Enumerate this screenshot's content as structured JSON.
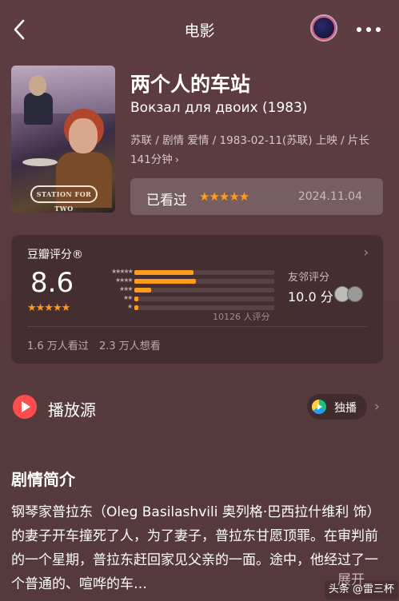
{
  "header": {
    "title": "电影",
    "back_icon": "chevron-left-icon",
    "more_icon": "more-dots-icon"
  },
  "movie": {
    "title_cn": "两个人的车站",
    "title_original": "Вокзал для двоих (1983)",
    "meta_line1": "苏联 / 剧情 爱情 / 1983-02-11(苏联) 上映 / 片长",
    "meta_line2": "141分钟",
    "poster_logo_text": "STATION FOR TWO"
  },
  "watched": {
    "label": "已看过",
    "stars": "★★★★★",
    "date": "2024.11.04"
  },
  "rating": {
    "header": "豆瓣评分®",
    "score": "8.6",
    "score_stars": "★★★★★",
    "distribution": [
      {
        "stars": "★★★★★",
        "percent": 42
      },
      {
        "stars": "★★★★",
        "percent": 44
      },
      {
        "stars": "★★★",
        "percent": 12
      },
      {
        "stars": "★★",
        "percent": 3
      },
      {
        "stars": "★",
        "percent": 2
      }
    ],
    "count": "10126 人评分",
    "friends_label": "友邻评分",
    "friends_score": "10.0 分",
    "seen": "1.6 万人看过",
    "want": "2.3 万人想看"
  },
  "play_source": {
    "label": "播放源",
    "badge": "独播"
  },
  "synopsis": {
    "title": "剧情简介",
    "text": "钢琴家普拉东（Oleg Basilashvili 奥列格·巴西拉什维利 饰）的妻子开车撞死了人，为了妻子，普拉东甘愿顶罪。在审判前的一个星期，普拉东赶回家见父亲的一面。途中，他经过了一个普通的、喧哗的车…",
    "expand": "展开"
  },
  "watermark": "头条 @雷三杯",
  "colors": {
    "background": "#5a3a3e",
    "star": "#ff9c1a",
    "play_red": "#ff4d4d"
  }
}
